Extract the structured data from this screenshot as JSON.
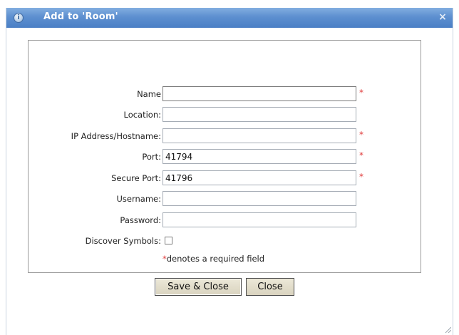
{
  "dialog": {
    "title": "Add to 'Room'",
    "close_glyph": "×",
    "help_icon": "info-icon"
  },
  "form": {
    "fields": [
      {
        "key": "name",
        "label": "Name",
        "value": "",
        "required": true
      },
      {
        "key": "location",
        "label": "Location:",
        "value": "",
        "required": false
      },
      {
        "key": "ip",
        "label": "IP Address/Hostname:",
        "value": "",
        "required": true
      },
      {
        "key": "port",
        "label": "Port:",
        "value": "41794",
        "required": true
      },
      {
        "key": "secure_port",
        "label": "Secure Port:",
        "value": "41796",
        "required": true
      },
      {
        "key": "username",
        "label": "Username:",
        "value": "",
        "required": false
      },
      {
        "key": "password",
        "label": "Password:",
        "value": "",
        "required": false
      }
    ],
    "discover_symbols": {
      "label": "Discover Symbols:",
      "checked": false
    },
    "required_marker": "*",
    "required_note": "denotes a required field"
  },
  "buttons": {
    "save_close": "Save & Close",
    "close": "Close"
  },
  "colors": {
    "titlebar": "#5d8fd0",
    "required": "#e03a3a",
    "button_face": "#d9d3bf"
  }
}
